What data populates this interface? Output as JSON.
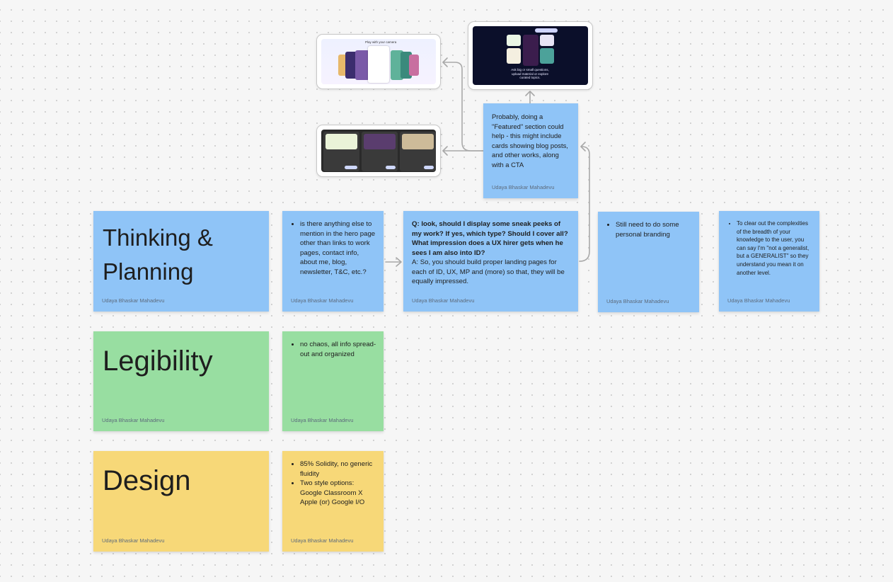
{
  "board": {
    "author": "Udaya Bhaskar Mahadevu",
    "colors": {
      "blue": "#8fc4f7",
      "green": "#98dea1",
      "yellow": "#f7d878",
      "canvas": "#f6f6f6"
    }
  },
  "stickies": {
    "thinking": {
      "title_line1": "Thinking &",
      "title_line2": "Planning"
    },
    "legibility": {
      "title": "Legibility"
    },
    "design": {
      "title": "Design"
    },
    "hero_question": {
      "items": [
        "is there anything else to mention in the hero page other than links to work pages, contact info, about me, blog, newsletter, T&C, etc.?"
      ]
    },
    "sneak_peeks": {
      "question": "Q: look, should I display some sneak peeks of my work? If yes, which type? Should I cover all? What impression does a UX hirer gets when he sees I am also into ID?",
      "answer": "A: So, you should build proper landing pages for each of ID, UX, MP and (more) so that, they will be equally impressed."
    },
    "branding": {
      "items": [
        "Still need to do some personal branding"
      ]
    },
    "generalist": {
      "items": [
        "To clear out the complexities of the breadth of your knowledge to the user, you can say I'm \"not a generalist, but a GENERALIST\" so they understand you mean it on another level."
      ]
    },
    "legibility_note": {
      "items": [
        "no chaos, all info spread-out and organized"
      ]
    },
    "design_note": {
      "items": [
        "85% Solidity, no generic fluidity",
        "Two style options: Google Classroom X Apple (or) Google I/O"
      ]
    },
    "featured": {
      "text": "Probably, doing a \"Featured\" section could help - this might include cards showing blog posts, and other works, along with a CTA"
    }
  },
  "screenshots": {
    "camera": {
      "caption": "Play with your camera"
    },
    "ask": {
      "caption": "Ask big or small questions, upload material or explore curated topics."
    }
  }
}
